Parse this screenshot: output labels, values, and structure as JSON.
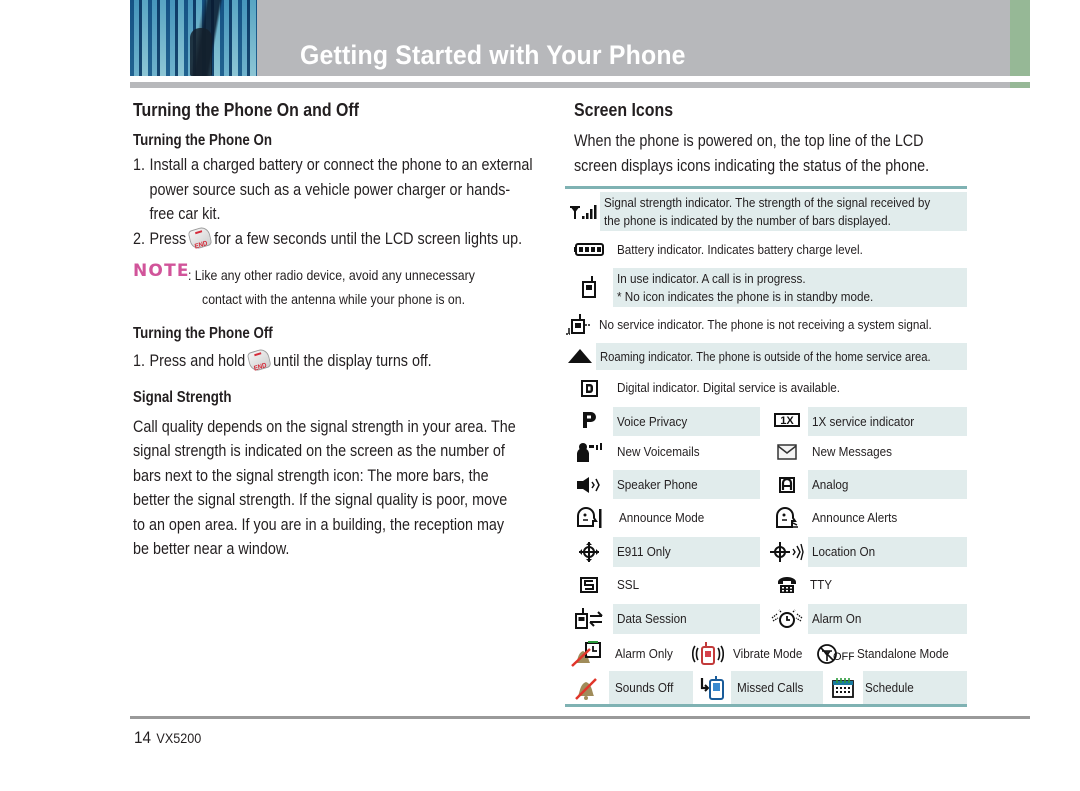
{
  "header": {
    "title": "Getting Started with Your Phone",
    "accent_color": "#96b896",
    "banner_color": "#b7b8bb"
  },
  "left": {
    "section_title": "Turning the Phone On and Off",
    "on": {
      "title": "Turning the Phone On",
      "steps": [
        {
          "num": "1.",
          "text": "Install a charged battery or connect the phone to an external power source such as a vehicle power charger or hands-free car kit."
        },
        {
          "num": "2.",
          "before": "Press",
          "key_icon": "end-key-icon",
          "after": "for a few seconds until the LCD screen lights up."
        }
      ]
    },
    "note": {
      "label": "NOTE",
      "line1": ": Like any other radio device, avoid any unnecessary",
      "line2": "contact with the antenna while your phone is on.",
      "label_color": "#d1549a"
    },
    "off": {
      "title": "Turning the Phone Off",
      "steps": [
        {
          "num": "1.",
          "before": "Press and hold",
          "key_icon": "end-key-icon",
          "after": "until the display turns off."
        }
      ]
    },
    "signal": {
      "title": "Signal Strength",
      "text": "Call quality depends on the signal strength in your area. The signal strength is indicated on the screen as the number of bars next to the signal strength icon: The more bars, the better the signal strength. If the signal quality is poor, move to an open area. If you are in a building, the reception may be better near a window."
    }
  },
  "right": {
    "section_title": "Screen Icons",
    "intro": "When the phone is powered on, the top line of the LCD screen displays icons indicating the status of the phone.",
    "table_rule_color": "#7fb2b3",
    "row_shade_color": "#e1ecec",
    "single_rows": [
      {
        "icon": "signal-strength-icon",
        "lines": [
          "Signal strength indicator. The strength of the signal received by",
          "the phone is indicated by the number of bars displayed."
        ],
        "shaded": true
      },
      {
        "icon": "battery-icon",
        "lines": [
          "Battery indicator. Indicates battery charge level."
        ],
        "shaded": false
      },
      {
        "icon": "in-use-icon",
        "lines": [
          "In use indicator. A call is in progress.",
          "* No icon indicates the phone is in standby mode."
        ],
        "shaded": true
      },
      {
        "icon": "no-service-icon",
        "lines": [
          "No service indicator. The phone is not receiving a system signal."
        ],
        "shaded": false
      },
      {
        "icon": "roaming-icon",
        "lines": [
          "Roaming indicator. The phone is outside of the home service area."
        ],
        "shaded": true
      },
      {
        "icon": "digital-icon",
        "lines": [
          "Digital indicator. Digital service is available."
        ],
        "shaded": false
      }
    ],
    "pair_rows": [
      {
        "left": {
          "icon": "voice-privacy-icon",
          "label": "Voice Privacy"
        },
        "right": {
          "icon": "1x-service-icon",
          "label": "1X service indicator"
        },
        "shaded": true
      },
      {
        "left": {
          "icon": "new-voicemail-icon",
          "label": "New Voicemails"
        },
        "right": {
          "icon": "new-message-icon",
          "label": "New Messages"
        },
        "shaded": false
      },
      {
        "left": {
          "icon": "speaker-phone-icon",
          "label": "Speaker Phone"
        },
        "right": {
          "icon": "analog-icon",
          "label": "Analog"
        },
        "shaded": true
      },
      {
        "left": {
          "icon": "announce-mode-icon",
          "label": "Announce Mode"
        },
        "right": {
          "icon": "announce-alerts-icon",
          "label": "Announce Alerts"
        },
        "shaded": false
      },
      {
        "left": {
          "icon": "e911-icon",
          "label": "E911 Only"
        },
        "right": {
          "icon": "location-on-icon",
          "label": "Location On"
        },
        "shaded": true
      },
      {
        "left": {
          "icon": "ssl-icon",
          "label": "SSL"
        },
        "right": {
          "icon": "tty-icon",
          "label": "TTY"
        },
        "shaded": false
      },
      {
        "left": {
          "icon": "data-session-icon",
          "label": "Data Session"
        },
        "right": {
          "icon": "alarm-on-icon",
          "label": "Alarm On"
        },
        "shaded": true
      }
    ],
    "triple_rows": [
      {
        "items": [
          {
            "icon": "alarm-only-icon",
            "label": "Alarm Only"
          },
          {
            "icon": "vibrate-mode-icon",
            "label": "Vibrate Mode"
          },
          {
            "icon": "standalone-mode-icon",
            "label": "Standalone Mode"
          }
        ],
        "shaded": false
      },
      {
        "items": [
          {
            "icon": "sounds-off-icon",
            "label": "Sounds Off"
          },
          {
            "icon": "missed-calls-icon",
            "label": "Missed Calls"
          },
          {
            "icon": "schedule-icon",
            "label": "Schedule"
          }
        ],
        "shaded": true
      }
    ]
  },
  "footer": {
    "page_number": "14",
    "model": "VX5200"
  }
}
